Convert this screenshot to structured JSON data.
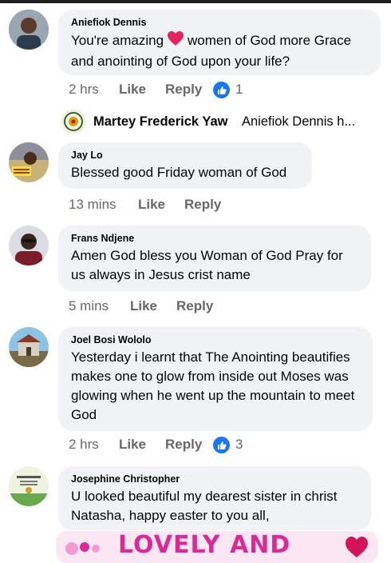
{
  "comments": [
    {
      "name": "Aniefiok Dennis",
      "text_before": "You're amazing",
      "text_after": "women of God more Grace and anointing of God upon your life?",
      "time": "2 hrs",
      "like": "Like",
      "reply": "Reply",
      "reactions": "1"
    },
    {
      "name": "Jay Lo",
      "text": "Blessed good Friday woman of God",
      "time": "13 mins",
      "like": "Like",
      "reply": "Reply"
    },
    {
      "name": "Frans Ndjene",
      "text": "Amen God bless you Woman of God Pray for us always in Jesus crist name",
      "time": "5 mins",
      "like": "Like",
      "reply": "Reply"
    },
    {
      "name": "Joel Bosi Wololo",
      "text": "Yesterday i learnt that The Anointing beautifies makes one to glow from inside out Moses was glowing when he went up the mountain to meet God",
      "time": "2 hrs",
      "like": "Like",
      "reply": "Reply",
      "reactions": "3"
    },
    {
      "name": "Josephine Christopher",
      "text": "U looked beautiful my dearest sister in christ Natasha, happy easter to you all,"
    }
  ],
  "reply_preview": {
    "name": "Martey Frederick Yaw",
    "snippet": "Aniefiok Dennis h..."
  },
  "banner_text": "LOVELY AND",
  "colors": {
    "bubble": "#f0f2f5",
    "meta": "#65676b",
    "like_blue": "#1877f2",
    "heart_red": "#e0245e",
    "banner_pink": "#d92a96"
  }
}
